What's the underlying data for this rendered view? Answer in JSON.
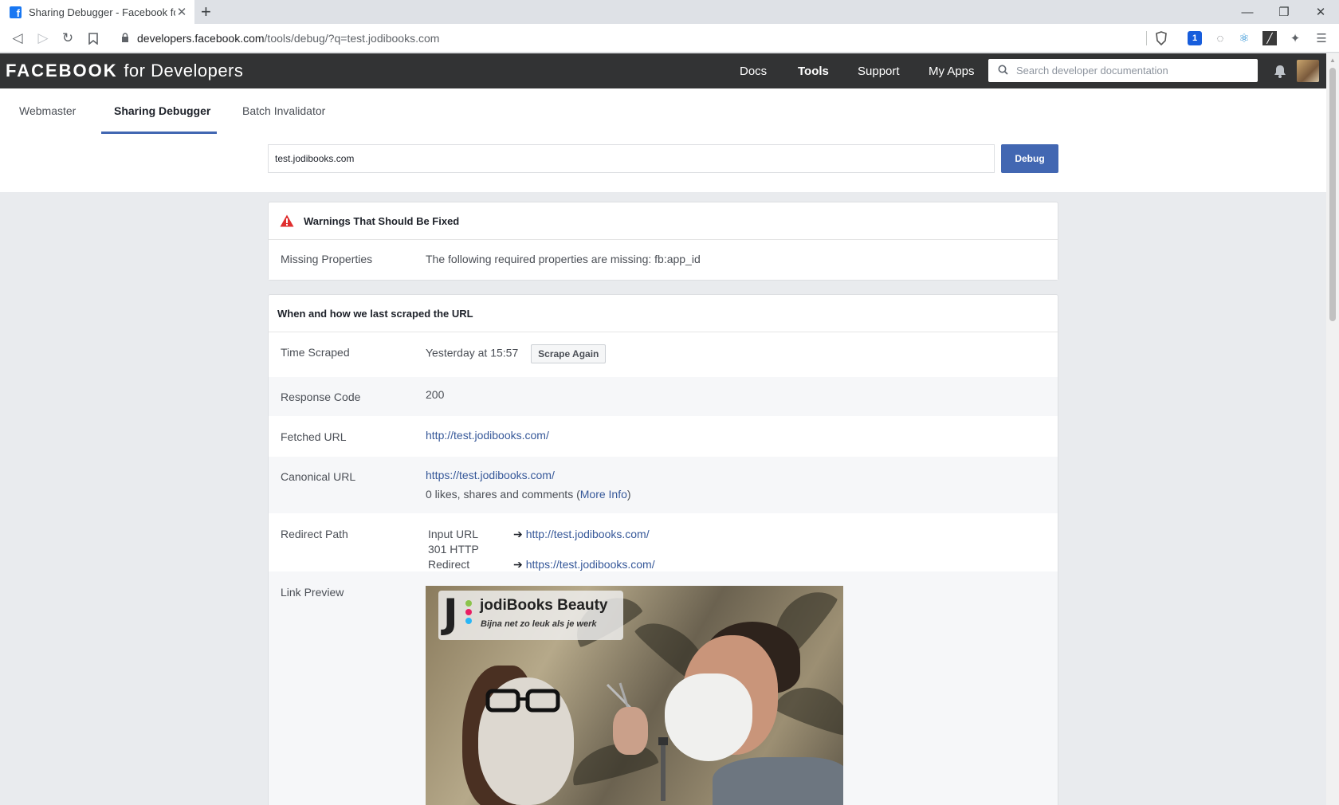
{
  "browser": {
    "tab_title": "Sharing Debugger - Facebook for",
    "url_host": "developers.facebook.com",
    "url_rest": "/tools/debug/?q=test.jodibooks.com"
  },
  "header": {
    "logo_brand": "FACEBOOK",
    "logo_suffix": "for Developers",
    "nav": [
      "Docs",
      "Tools",
      "Support",
      "My Apps"
    ],
    "search_placeholder": "Search developer documentation"
  },
  "subnav": {
    "tabs": [
      "Webmaster",
      "Sharing Debugger",
      "Batch Invalidator"
    ],
    "active_tab": "Sharing Debugger"
  },
  "debug_form": {
    "input_value": "test.jodibooks.com",
    "button_label": "Debug"
  },
  "warnings": {
    "title": "Warnings That Should Be Fixed",
    "label": "Missing Properties",
    "message": "The following required properties are missing: fb:app_id"
  },
  "scrape": {
    "title": "When and how we last scraped the URL",
    "time_label": "Time Scraped",
    "time_value": "Yesterday at 15:57",
    "scrape_again": "Scrape Again",
    "response_label": "Response Code",
    "response_value": "200",
    "fetched_label": "Fetched URL",
    "fetched_value": "http://test.jodibooks.com/",
    "canonical_label": "Canonical URL",
    "canonical_value": "https://test.jodibooks.com/",
    "likes_text": "0 likes, shares and comments (",
    "more_info": "More Info",
    "likes_close": ")",
    "redirect_label": "Redirect Path",
    "redirects": [
      {
        "kind": "Input URL",
        "url": "http://test.jodibooks.com/"
      },
      {
        "kind": "301 HTTP Redirect",
        "url": "https://test.jodibooks.com/"
      }
    ],
    "preview_label": "Link Preview",
    "preview_brand": "jodiBooks Beauty",
    "preview_tagline": "Bijna net zo leuk als je werk"
  },
  "colors": {
    "header_bg": "#323334",
    "accent": "#4267b2",
    "link": "#365899",
    "warning": "#e02f2f"
  }
}
